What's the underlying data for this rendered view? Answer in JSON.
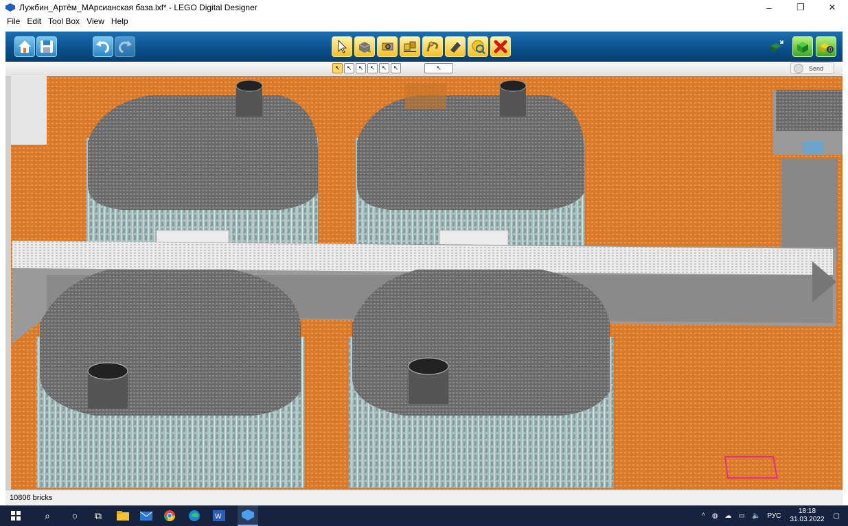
{
  "window": {
    "title": "Лужбин_Артём_МАрсианская база.lxf* - LEGO Digital Designer",
    "minimize": "–",
    "restore": "❐",
    "close": "✕"
  },
  "menu": [
    "File",
    "Edit",
    "Tool Box",
    "View",
    "Help"
  ],
  "toolbar": {
    "left": [
      "home-icon",
      "save-icon",
      "undo-icon",
      "redo-icon"
    ],
    "center": [
      "select-tool-icon",
      "clone-tool-icon",
      "hinge-tool-icon",
      "hinge-align-tool-icon",
      "flex-tool-icon",
      "paint-tool-icon",
      "hide-tool-icon",
      "delete-tool-icon"
    ],
    "right": [
      "build-mode-icon",
      "view-mode-icon",
      "building-guide-icon"
    ]
  },
  "subtoolbar": {
    "send_label": "Send"
  },
  "status": {
    "brick_count": "10806 bricks"
  },
  "taskbar": {
    "keyboard_lang": "РУС",
    "time": "18:18",
    "date": "31.03.2022"
  },
  "colors": {
    "baseplate": "#d97a2b",
    "dome_top": "#6b6b6b",
    "dome_wall": "#9fb8b8",
    "corridor": "#d8d8d8",
    "toolbar": "#0a4f8a",
    "taskbar": "#15233f"
  }
}
